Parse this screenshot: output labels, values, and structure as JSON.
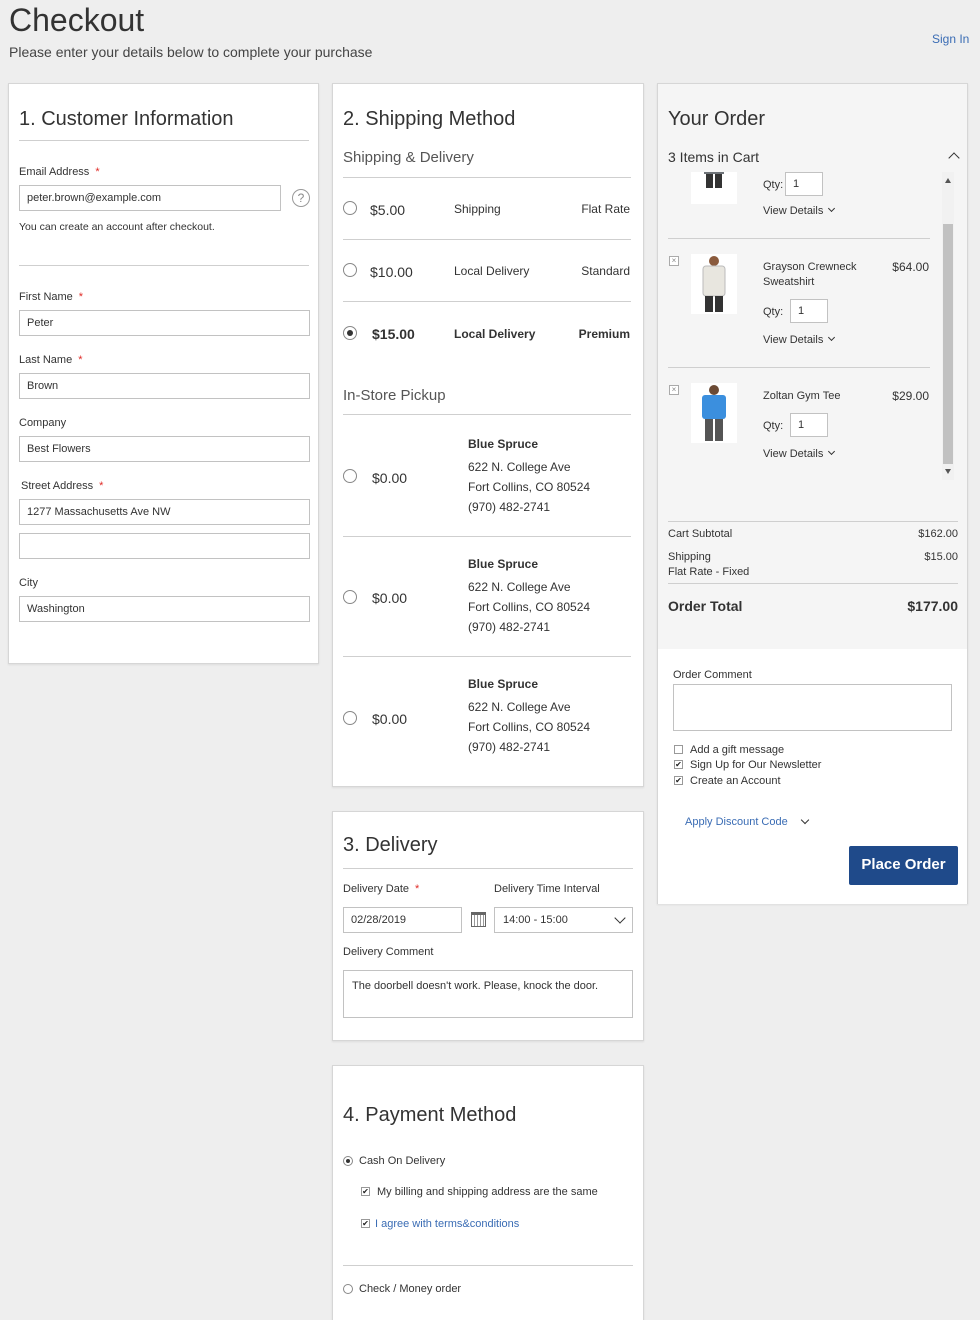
{
  "page": {
    "title": "Checkout",
    "subtitle": "Please enter your details below to complete your purchase",
    "sign_in": "Sign In"
  },
  "customer": {
    "title": "1. Customer Information",
    "email_label": "Email Address",
    "email_value": "peter.brown@example.com",
    "email_hint": "You can create an account after checkout.",
    "first_name_label": "First Name",
    "first_name_value": "Peter",
    "last_name_label": "Last Name",
    "last_name_value": "Brown",
    "company_label": "Company",
    "company_value": "Best Flowers",
    "street_label": "Street Address",
    "street_value_1": "1277 Massachusetts Ave NW",
    "street_value_2": "",
    "city_label": "City",
    "city_value": "Washington",
    "required_mark": "*",
    "help_glyph": "?"
  },
  "shipping": {
    "title": "2. Shipping Method",
    "delivery_heading": "Shipping & Delivery",
    "rates": [
      {
        "price": "$5.00",
        "method": "Shipping",
        "carrier": "Flat Rate",
        "selected": false
      },
      {
        "price": "$10.00",
        "method": "Local Delivery",
        "carrier": "Standard",
        "selected": false
      },
      {
        "price": "$15.00",
        "method": "Local Delivery",
        "carrier": "Premium",
        "selected": true
      }
    ],
    "pickup_heading": "In-Store Pickup",
    "stores": [
      {
        "price": "$0.00",
        "name": "Blue Spruce",
        "street": "622 N. College Ave",
        "city": "Fort Collins, CO 80524",
        "phone": "(970) 482-2741"
      },
      {
        "price": "$0.00",
        "name": "Blue Spruce",
        "street": "622 N. College Ave",
        "city": "Fort Collins, CO 80524",
        "phone": "(970) 482-2741"
      },
      {
        "price": "$0.00",
        "name": "Blue Spruce",
        "street": "622 N. College Ave",
        "city": "Fort Collins, CO 80524",
        "phone": "(970) 482-2741"
      }
    ]
  },
  "delivery": {
    "title": "3. Delivery",
    "date_label": "Delivery Date",
    "date_value": "02/28/2019",
    "interval_label": "Delivery Time Interval",
    "interval_value": "14:00 - 15:00",
    "comment_label": "Delivery Comment",
    "comment_value": "The doorbell doesn't work. Please, knock the door."
  },
  "payment": {
    "title": "4. Payment Method",
    "cod_label": "Cash On Delivery",
    "cod_selected": true,
    "same_address_label": "My billing and shipping address are the same",
    "agree_label": "I agree with terms&conditions",
    "check_label": "Check / Money order",
    "check_selected": false
  },
  "order": {
    "title": "Your Order",
    "items_count": "3 Items in Cart",
    "qty_label": "Qty:",
    "view_details": "View Details",
    "remove_glyph": "×",
    "items": [
      {
        "name": "",
        "price": "",
        "qty": "1",
        "shirt_color": "#6e7378"
      },
      {
        "name": "Grayson Crewneck Sweatshirt",
        "price": "$64.00",
        "qty": "1",
        "shirt_color": "#e8e6df"
      },
      {
        "name": "Zoltan Gym Tee",
        "price": "$29.00",
        "qty": "1",
        "shirt_color": "#3b8fde"
      }
    ],
    "subtotal_label": "Cart Subtotal",
    "subtotal_value": "$162.00",
    "shipping_label": "Shipping",
    "shipping_sub": "Flat Rate - Fixed",
    "shipping_value": "$15.00",
    "total_label": "Order Total",
    "total_value": "$177.00",
    "comment_label": "Order Comment",
    "gift_label": "Add a gift message",
    "gift_checked": false,
    "newsletter_label": "Sign Up for Our Newsletter",
    "newsletter_checked": true,
    "account_label": "Create an Account",
    "account_checked": true,
    "discount_label": "Apply Discount Code",
    "place_order": "Place Order",
    "check_glyph": "✔"
  },
  "colors": {
    "accent": "#1f4a8a",
    "link": "#3a6cb4",
    "required": "#e02b27"
  }
}
